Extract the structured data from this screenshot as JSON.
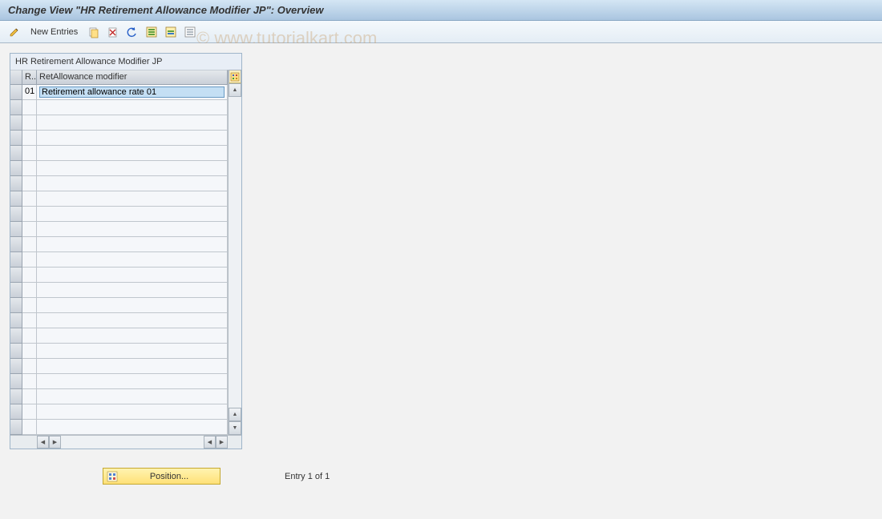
{
  "title": "Change View \"HR Retirement Allowance Modifier JP\": Overview",
  "toolbar": {
    "new_entries_label": "New Entries"
  },
  "panel": {
    "title": "HR Retirement Allowance Modifier JP",
    "columns": {
      "r": "R..",
      "mod": "RetAllowance modifier"
    },
    "rows": [
      {
        "r": "01",
        "mod": "Retirement allowance rate 01"
      }
    ],
    "empty_row_count": 22
  },
  "footer": {
    "position_label": "Position...",
    "entry_text": "Entry 1 of 1"
  },
  "watermark": "© www.tutorialkart.com"
}
